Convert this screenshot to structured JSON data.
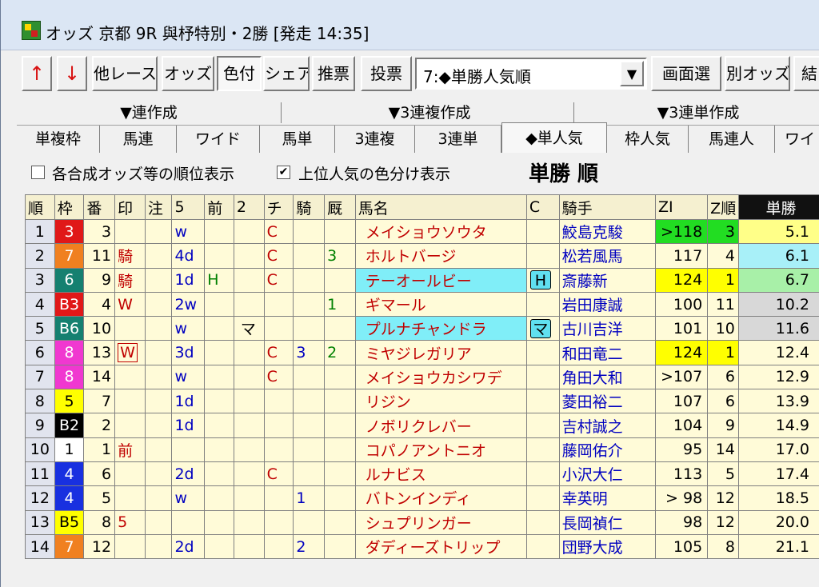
{
  "window": {
    "title": "オッズ 京都 9R 與杼特別・2勝 [発走 14:35]"
  },
  "toolbar": {
    "up_arrow": "↑",
    "down_arrow": "↓",
    "other_race": "他レース",
    "odds": "オッズ",
    "coloring": "色付",
    "share": "シェア",
    "recommend": "推票",
    "vote": "投票",
    "sort_select": "7:◆単勝人気順",
    "screen_select": "画面選",
    "separate_odds": "別オッズ",
    "result": "結"
  },
  "groups": [
    "▼連作成",
    "▼3連複作成",
    "▼3連単作成"
  ],
  "tabs": [
    "単複枠",
    "馬連",
    "ワイド",
    "馬単",
    "3連複",
    "3連単",
    "◆単人気",
    "枠人気",
    "馬連人",
    "ワイ"
  ],
  "active_tab": "◆単人気",
  "options": {
    "order_display": {
      "label": "各合成オッズ等の順位表示",
      "checked": false
    },
    "color_split": {
      "label": "上位人気の色分け表示",
      "checked": true
    },
    "table_title": "単勝 順"
  },
  "columns": [
    "順",
    "枠",
    "番",
    "印",
    "注",
    "5",
    "前",
    "2",
    "チ",
    "騎",
    "厩",
    "馬名",
    "C",
    "騎手",
    "ZI",
    "Z順",
    "単勝"
  ],
  "rows": [
    {
      "jun": "1",
      "waku": "3",
      "ban": "3",
      "shirushi": "",
      "chu": "",
      "five": "w",
      "mae": "",
      "two": "",
      "chi": "C",
      "ki": "",
      "kyu": "",
      "name": "メイショウソウタ",
      "c": "",
      "jockey": "鮫島克駿",
      "zi": ">118",
      "zj": "3",
      "tansho": "5.1",
      "wakuColor": "#e01818",
      "wakuText": "#ffffff",
      "ziBg": "#22dd22",
      "zjBg": "#22dd22",
      "tanBg": "#ffff88",
      "nameBg": "",
      "boxShirushi": false
    },
    {
      "jun": "2",
      "waku": "7",
      "ban": "11",
      "shirushi": "騎",
      "chu": "",
      "five": "4d",
      "mae": "",
      "two": "",
      "chi": "C",
      "ki": "",
      "kyu": "3",
      "name": "ホルトバージ",
      "c": "",
      "jockey": "松若風馬",
      "zi": "117",
      "zj": "4",
      "tansho": "6.1",
      "wakuColor": "#f08020",
      "wakuText": "#ffffff",
      "ziBg": "",
      "zjBg": "",
      "tanBg": "#a8f0f8",
      "nameBg": "",
      "boxShirushi": false
    },
    {
      "jun": "3",
      "waku": "6",
      "ban": "9",
      "shirushi": "騎",
      "chu": "",
      "five": "1d",
      "mae": "H",
      "two": "",
      "chi": "C",
      "ki": "",
      "kyu": "",
      "name": "テーオールビー",
      "c": "H",
      "jockey": "斎藤新",
      "zi": "124",
      "zj": "1",
      "tansho": "6.7",
      "wakuColor": "#158070",
      "wakuText": "#ffffff",
      "ziBg": "#ffff00",
      "zjBg": "#ffff00",
      "tanBg": "#a8f0a8",
      "nameBg": "#80eef8",
      "boxShirushi": false
    },
    {
      "jun": "4",
      "waku": "B3",
      "ban": "4",
      "shirushi": "W",
      "chu": "",
      "five": "2w",
      "mae": "",
      "two": "",
      "chi": "",
      "ki": "",
      "kyu": "1",
      "name": "ギマール",
      "c": "",
      "jockey": "岩田康誠",
      "zi": "100",
      "zj": "11",
      "tansho": "10.2",
      "wakuColor": "#e01818",
      "wakuText": "#ffffff",
      "ziBg": "",
      "zjBg": "",
      "tanBg": "#d8d8d8",
      "nameBg": "",
      "boxShirushi": false
    },
    {
      "jun": "5",
      "waku": "B6",
      "ban": "10",
      "shirushi": "",
      "chu": "",
      "five": "w",
      "mae": "",
      "two": "マ",
      "chi": "",
      "ki": "",
      "kyu": "",
      "name": "プルナチャンドラ",
      "c": "マ",
      "jockey": "古川吉洋",
      "zi": "101",
      "zj": "10",
      "tansho": "11.6",
      "wakuColor": "#158070",
      "wakuText": "#ffffff",
      "ziBg": "",
      "zjBg": "",
      "tanBg": "#d8d8d8",
      "nameBg": "#80eef8",
      "boxShirushi": false
    },
    {
      "jun": "6",
      "waku": "8",
      "ban": "13",
      "shirushi": "W",
      "chu": "",
      "five": "3d",
      "mae": "",
      "two": "",
      "chi": "C",
      "ki": "3",
      "kyu": "2",
      "name": "ミヤジレガリア",
      "c": "",
      "jockey": "和田竜二",
      "zi": "124",
      "zj": "1",
      "tansho": "12.4",
      "wakuColor": "#f038d0",
      "wakuText": "#ffffff",
      "ziBg": "#ffff00",
      "zjBg": "#ffff00",
      "tanBg": "",
      "nameBg": "",
      "boxShirushi": true
    },
    {
      "jun": "7",
      "waku": "8",
      "ban": "14",
      "shirushi": "",
      "chu": "",
      "five": "w",
      "mae": "",
      "two": "",
      "chi": "C",
      "ki": "",
      "kyu": "",
      "name": "メイショウカシワデ",
      "c": "",
      "jockey": "角田大和",
      "zi": ">107",
      "zj": "6",
      "tansho": "12.9",
      "wakuColor": "#f038d0",
      "wakuText": "#ffffff",
      "ziBg": "",
      "zjBg": "",
      "tanBg": "",
      "nameBg": "",
      "boxShirushi": false
    },
    {
      "jun": "8",
      "waku": "5",
      "ban": "7",
      "shirushi": "",
      "chu": "",
      "five": "1d",
      "mae": "",
      "two": "",
      "chi": "",
      "ki": "",
      "kyu": "",
      "name": "リジン",
      "c": "",
      "jockey": "菱田裕二",
      "zi": "107",
      "zj": "6",
      "tansho": "13.9",
      "wakuColor": "#ffff00",
      "wakuText": "#000000",
      "ziBg": "",
      "zjBg": "",
      "tanBg": "",
      "nameBg": "",
      "boxShirushi": false
    },
    {
      "jun": "9",
      "waku": "B2",
      "ban": "2",
      "shirushi": "",
      "chu": "",
      "five": "1d",
      "mae": "",
      "two": "",
      "chi": "",
      "ki": "",
      "kyu": "",
      "name": "ノボリクレバー",
      "c": "",
      "jockey": "吉村誠之",
      "zi": "104",
      "zj": "9",
      "tansho": "14.9",
      "wakuColor": "#000000",
      "wakuText": "#ffffff",
      "ziBg": "",
      "zjBg": "",
      "tanBg": "",
      "nameBg": "",
      "boxShirushi": false
    },
    {
      "jun": "10",
      "waku": "1",
      "ban": "1",
      "shirushi": "前",
      "chu": "",
      "five": "",
      "mae": "",
      "two": "",
      "chi": "",
      "ki": "",
      "kyu": "",
      "name": "コパノアントニオ",
      "c": "",
      "jockey": "藤岡佑介",
      "zi": "95",
      "zj": "14",
      "tansho": "17.0",
      "wakuColor": "#ffffff",
      "wakuText": "#000000",
      "ziBg": "",
      "zjBg": "",
      "tanBg": "",
      "nameBg": "",
      "boxShirushi": false
    },
    {
      "jun": "11",
      "waku": "4",
      "ban": "6",
      "shirushi": "",
      "chu": "",
      "five": "2d",
      "mae": "",
      "two": "",
      "chi": "C",
      "ki": "",
      "kyu": "",
      "name": "ルナビス",
      "c": "",
      "jockey": "小沢大仁",
      "zi": "113",
      "zj": "5",
      "tansho": "17.4",
      "wakuColor": "#1830e0",
      "wakuText": "#ffffff",
      "ziBg": "",
      "zjBg": "",
      "tanBg": "",
      "nameBg": "",
      "boxShirushi": false
    },
    {
      "jun": "12",
      "waku": "4",
      "ban": "5",
      "shirushi": "",
      "chu": "",
      "five": "w",
      "mae": "",
      "two": "",
      "chi": "",
      "ki": "1",
      "kyu": "",
      "name": "バトンインディ",
      "c": "",
      "jockey": "幸英明",
      "zi": "> 98",
      "zj": "12",
      "tansho": "18.5",
      "wakuColor": "#1830e0",
      "wakuText": "#ffffff",
      "ziBg": "",
      "zjBg": "",
      "tanBg": "",
      "nameBg": "",
      "boxShirushi": false
    },
    {
      "jun": "13",
      "waku": "B5",
      "ban": "8",
      "shirushi": "5",
      "chu": "",
      "five": "",
      "mae": "",
      "two": "",
      "chi": "",
      "ki": "",
      "kyu": "",
      "name": "シュプリンガー",
      "c": "",
      "jockey": "長岡禎仁",
      "zi": "98",
      "zj": "12",
      "tansho": "20.0",
      "wakuColor": "#ffff00",
      "wakuText": "#000000",
      "ziBg": "",
      "zjBg": "",
      "tanBg": "",
      "nameBg": "",
      "boxShirushi": false
    },
    {
      "jun": "14",
      "waku": "7",
      "ban": "12",
      "shirushi": "",
      "chu": "",
      "five": "2d",
      "mae": "",
      "two": "",
      "chi": "",
      "ki": "2",
      "kyu": "",
      "name": "ダディーズトリップ",
      "c": "",
      "jockey": "団野大成",
      "zi": "105",
      "zj": "8",
      "tansho": "21.1",
      "wakuColor": "#f08020",
      "wakuText": "#ffffff",
      "ziBg": "",
      "zjBg": "",
      "tanBg": "",
      "nameBg": "",
      "boxShirushi": false
    }
  ]
}
